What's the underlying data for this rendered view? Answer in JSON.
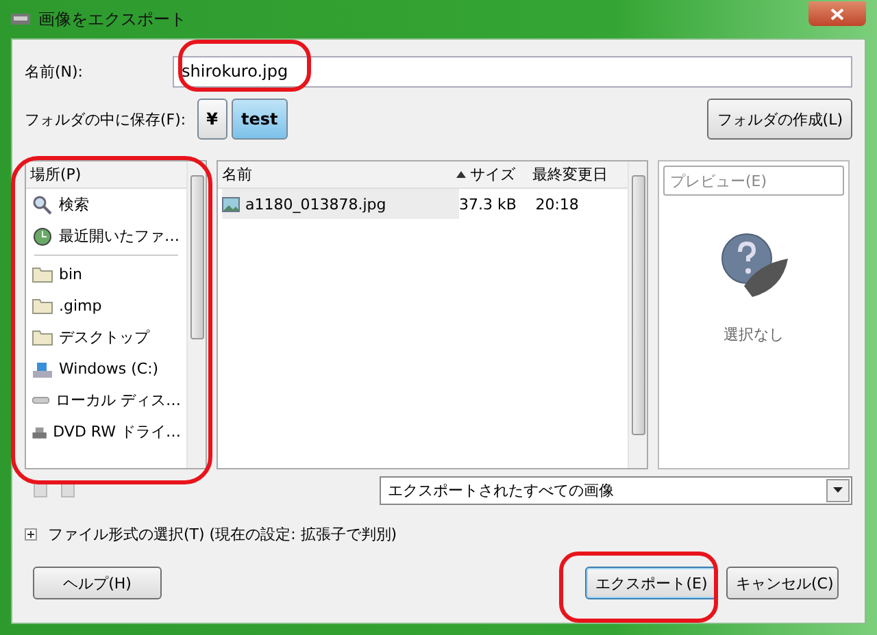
{
  "window": {
    "title": "画像をエクスポート"
  },
  "name_field": {
    "label": "名前(N):",
    "value": "shirokuro.jpg"
  },
  "folder": {
    "label": "フォルダの中に保存(F):",
    "path": [
      {
        "label": "¥",
        "selected": false
      },
      {
        "label": "test",
        "selected": true
      }
    ],
    "create_button": "フォルダの作成(L)"
  },
  "places": {
    "header": "場所(P)",
    "items": [
      {
        "kind": "search",
        "label": "検索"
      },
      {
        "kind": "recent",
        "label": "最近開いたファ…"
      }
    ],
    "bookmarks": [
      {
        "kind": "folder",
        "label": "bin"
      },
      {
        "kind": "folder",
        "label": ".gimp"
      },
      {
        "kind": "folder",
        "label": "デスクトップ"
      },
      {
        "kind": "windows",
        "label": "Windows (C:)"
      },
      {
        "kind": "disk",
        "label": "ローカル ディス…"
      },
      {
        "kind": "dvd",
        "label": "DVD RW ドライ…"
      }
    ]
  },
  "files": {
    "columns": [
      {
        "label": "名前",
        "sorted": false
      },
      {
        "label": "サイズ",
        "sorted": true
      },
      {
        "label": "最終変更日",
        "sorted": false
      }
    ],
    "rows": [
      {
        "name": "a1180_013878.jpg",
        "size": "37.3 kB",
        "modified": "20:18"
      }
    ]
  },
  "preview": {
    "header": "プレビュー(E)",
    "status": "選択なし"
  },
  "filter": {
    "value": "エクスポートされたすべての画像"
  },
  "file_type": {
    "label": "ファイル形式の選択(T) (現在の設定: 拡張子で判別)",
    "expanded": false
  },
  "buttons": [
    {
      "kind": "help",
      "label": "ヘルプ(H)",
      "focused": false
    },
    {
      "kind": "primary",
      "label": "エクスポート(E)",
      "focused": true
    },
    {
      "kind": "cancel",
      "label": "キャンセル(C)",
      "focused": false
    }
  ]
}
